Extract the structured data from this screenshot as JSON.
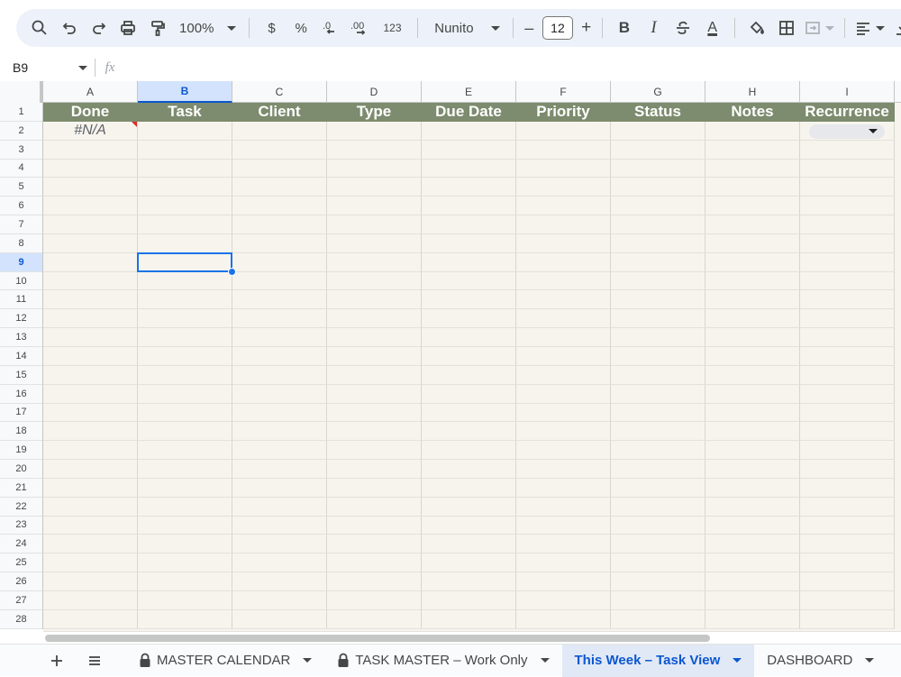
{
  "toolbar": {
    "zoom": "100%",
    "currency": "$",
    "percent": "%",
    "number_format": "123",
    "font": "Nunito",
    "font_size": "12",
    "minus": "–",
    "plus": "+",
    "bold": "B",
    "italic": "I",
    "text_color_glyph": "A"
  },
  "formula_bar": {
    "cell_ref": "B9",
    "fx_label": "fx",
    "formula": ""
  },
  "columns": [
    "A",
    "B",
    "C",
    "D",
    "E",
    "F",
    "G",
    "H",
    "I"
  ],
  "selected_column": "B",
  "rows": [
    "1",
    "2",
    "3",
    "4",
    "5",
    "6",
    "7",
    "8",
    "9",
    "10",
    "11",
    "12",
    "13",
    "14",
    "15",
    "16",
    "17",
    "18",
    "19",
    "20",
    "21",
    "22",
    "23",
    "24",
    "25",
    "26",
    "27",
    "28"
  ],
  "selected_row": "9",
  "header_row": [
    "Done",
    "Task",
    "Client",
    "Type",
    "Due Date",
    "Priority",
    "Status",
    "Notes",
    "Recurrence"
  ],
  "row2": {
    "a_value": "#N/A"
  },
  "sheet_tabs": [
    {
      "label": "MASTER CALENDAR",
      "locked": true,
      "active": false
    },
    {
      "label": "TASK MASTER – Work Only",
      "locked": true,
      "active": false
    },
    {
      "label": "This Week – Task View",
      "locked": false,
      "active": true
    },
    {
      "label": "DASHBOARD",
      "locked": false,
      "active": false
    }
  ],
  "colors": {
    "header_fill": "#7d8b6e",
    "cell_fill": "#f7f4ee",
    "selection": "#1a73e8",
    "active_tab_text": "#0b57d0"
  }
}
